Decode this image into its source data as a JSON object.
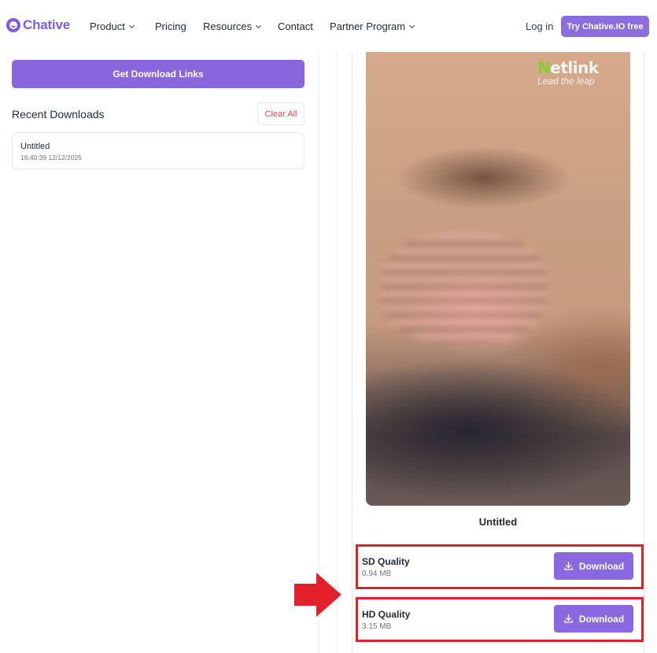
{
  "header": {
    "brand": "Chative",
    "nav": [
      "Product",
      "Pricing",
      "Resources",
      "Contact",
      "Partner Program"
    ],
    "login_label": "Log in",
    "cta_label": "Try Chative.IO free"
  },
  "left": {
    "get_links_label": "Get Download Links",
    "recent_title": "Recent Downloads",
    "clear_all_label": "Clear All",
    "recent_items": [
      {
        "name": "Untitled",
        "time": "16:40:39 12/12/2025"
      }
    ]
  },
  "result": {
    "watermark_brand": "Netlink",
    "watermark_tagline": "Lead the leap",
    "title": "Untitled",
    "qualities": [
      {
        "label": "SD Quality",
        "size": "0.94 MB",
        "button": "Download"
      },
      {
        "label": "HD Quality",
        "size": "3.15 MB",
        "button": "Download"
      }
    ]
  },
  "colors": {
    "accent": "#8b6ddf",
    "highlight_border": "#e3212b",
    "clear_text": "#ef4444"
  },
  "icons": [
    "chative-logo-icon",
    "chevron-down-icon",
    "download-icon",
    "red-arrow-icon"
  ]
}
